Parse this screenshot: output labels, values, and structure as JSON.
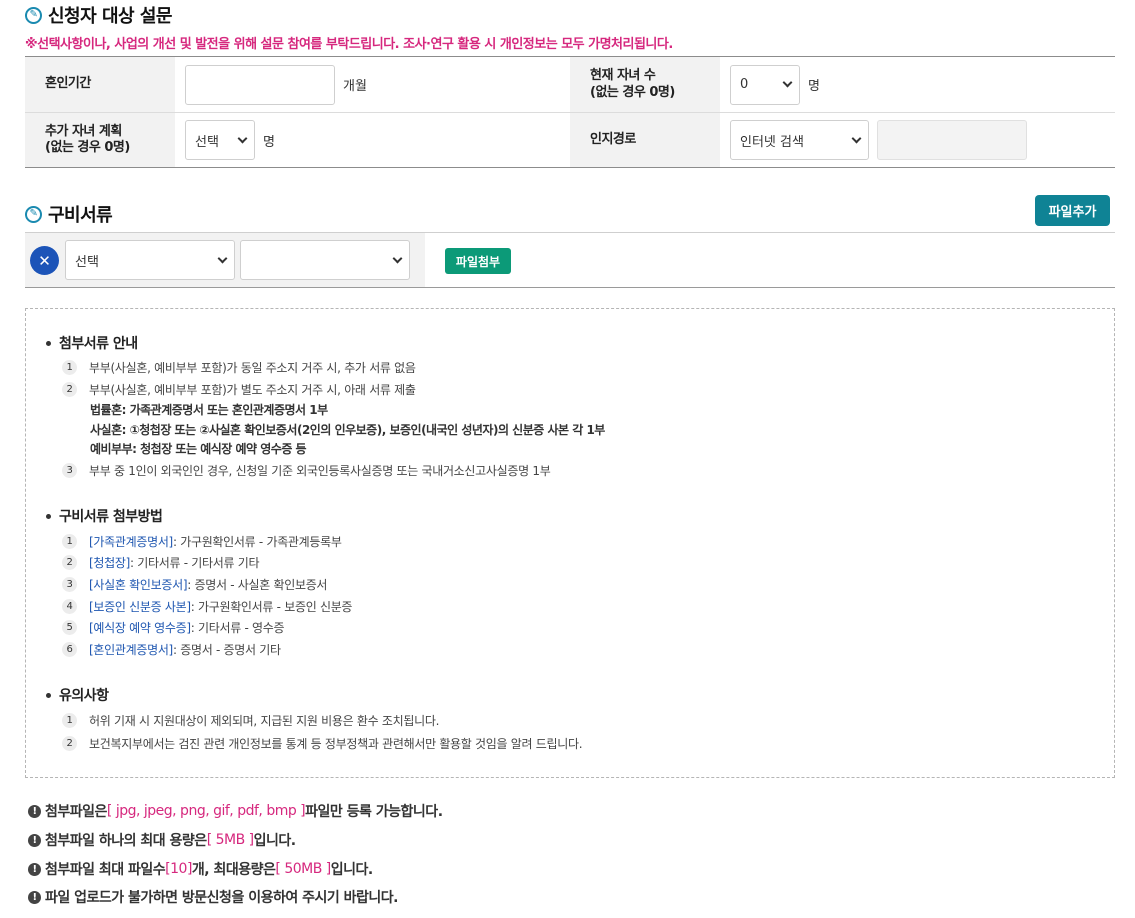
{
  "survey": {
    "title": "신청자 대상 설문",
    "notice": "※선택사항이나, 사업의 개선 및 발전을 위해 설문 참여를 부탁드립니다. 조사·연구 활용 시 개인정보는 모두 가명처리됩니다.",
    "marriage_label": "혼인기간",
    "marriage_value": "",
    "marriage_unit": "개월",
    "children_label": "현재 자녀 수\n(없는 경우 0명)",
    "children_value": "0",
    "children_unit": "명",
    "plan_label": "추가 자녀 계획\n(없는 경우 0명)",
    "plan_value": "선택",
    "plan_unit": "명",
    "route_label": "인지경로",
    "route_value": "인터넷 검색",
    "route_extra": ""
  },
  "docs": {
    "title": "구비서류",
    "add_button": "파일추가",
    "doc_select": "선택",
    "doc_sub_select": "",
    "attach_button": "파일첨부"
  },
  "guide": {
    "sections": [
      {
        "heading": "첨부서류 안내",
        "items": [
          {
            "num": "1",
            "text": "부부(사실혼, 예비부부 포함)가 동일 주소지 거주 시, 추가 서류 없음"
          },
          {
            "num": "2",
            "text": "부부(사실혼, 예비부부 포함)가 별도 주소지 거주 시, 아래 서류 제출"
          },
          {
            "num": "3",
            "text": "부부 중 1인이 외국인인 경우, 신청일 기준 외국인등록사실증명 또는 국내거소신고사실증명 1부"
          }
        ],
        "subs": [
          "법률혼: 가족관계증명서 또는 혼인관계증명서 1부",
          "사실혼: ①청첩장 또는 ②사실혼 확인보증서(2인의 인우보증), 보증인(내국인 성년자)의 신분증 사본 각 1부",
          "예비부부: 청첩장 또는 예식장 예약 영수증 등"
        ]
      },
      {
        "heading": "구비서류 첨부방법",
        "items": [
          {
            "num": "1",
            "link": "[가족관계증명서]",
            "text": " : 가구원확인서류 - 가족관계등록부"
          },
          {
            "num": "2",
            "link": "[청첩장]",
            "text": " : 기타서류 - 기타서류 기타"
          },
          {
            "num": "3",
            "link": "[사실혼 확인보증서]",
            "text": " : 증명서 - 사실혼 확인보증서"
          },
          {
            "num": "4",
            "link": "[보증인 신분증 사본]",
            "text": " : 가구원확인서류 - 보증인 신분증"
          },
          {
            "num": "5",
            "link": "[예식장 예약 영수증]",
            "text": " : 기타서류 - 영수증"
          },
          {
            "num": "6",
            "link": "[혼인관계증명서]",
            "text": " : 증명서 - 증명서 기타"
          }
        ]
      },
      {
        "heading": "유의사항",
        "items": [
          {
            "num": "1",
            "text": "허위 기재 시 지원대상이 제외되며, 지급된 지원 비용은 환수 조치됩니다."
          },
          {
            "num": "2",
            "text": "보건복지부에서는 검진 관련 개인정보를 통계 등 정부정책과 관련해서만 활용할 것임을 알려 드립니다."
          }
        ]
      }
    ]
  },
  "footnotes": [
    {
      "pre": "첨부파일은 ",
      "hl": "[ jpg, jpeg, png, gif, pdf, bmp ]",
      "post": " 파일만 등록 가능합니다."
    },
    {
      "pre": "첨부파일 하나의 최대 용량은 ",
      "hl": "[ 5MB ]",
      "post": " 입니다."
    },
    {
      "pre": "첨부파일 최대 파일수 ",
      "hl": "[10]",
      "post": " 개, 최대용량은 ",
      "hl2": "[ 50MB ]",
      "post2": " 입니다."
    },
    {
      "pre": "파일 업로드가 불가하면 방문신청을 이용하여 주시기 바랍니다.",
      "hl": "",
      "post": ""
    }
  ],
  "colors": {
    "accent": "#0f8395",
    "attach_button": "#0c9a78",
    "notice": "#d6287e",
    "link": "#1e56b0",
    "remove_button": "#1c54b8"
  },
  "icons": {
    "section": "pencil-circle-icon",
    "remove": "close-circle-icon",
    "footnote": "exclamation-circle-icon",
    "select": "chevron-down-icon"
  }
}
